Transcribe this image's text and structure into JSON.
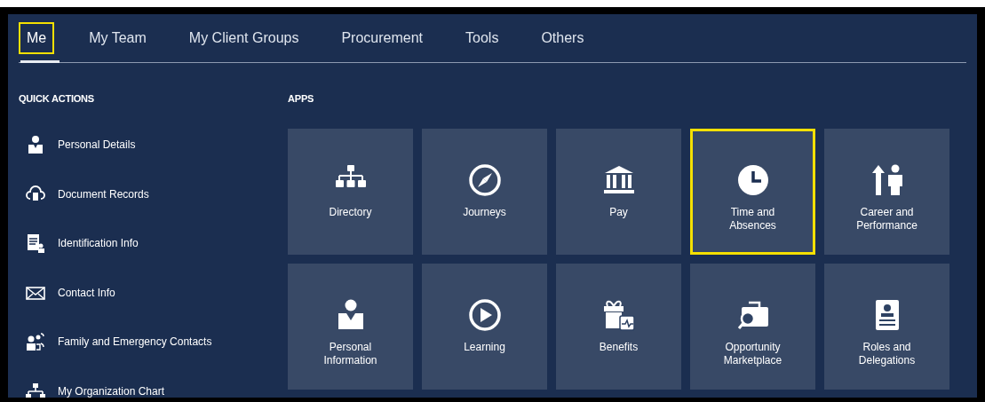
{
  "tabs": [
    {
      "label": "Me",
      "selected": true,
      "highlighted": true
    },
    {
      "label": "My Team",
      "selected": false,
      "highlighted": false
    },
    {
      "label": "My Client Groups",
      "selected": false,
      "highlighted": false
    },
    {
      "label": "Procurement",
      "selected": false,
      "highlighted": false
    },
    {
      "label": "Tools",
      "selected": false,
      "highlighted": false
    },
    {
      "label": "Others",
      "selected": false,
      "highlighted": false
    }
  ],
  "quick_actions": {
    "title": "QUICK ACTIONS",
    "items": [
      {
        "label": "Personal Details"
      },
      {
        "label": "Document Records"
      },
      {
        "label": "Identification Info"
      },
      {
        "label": "Contact Info"
      },
      {
        "label": "Family and Emergency Contacts"
      },
      {
        "label": "My Organization Chart"
      }
    ]
  },
  "apps": {
    "title": "APPS",
    "tiles": [
      {
        "label": "Directory",
        "highlighted": false
      },
      {
        "label": "Journeys",
        "highlighted": false
      },
      {
        "label": "Pay",
        "highlighted": false
      },
      {
        "label": "Time and Absences",
        "highlighted": true
      },
      {
        "label": "Career and Performance",
        "highlighted": false
      },
      {
        "label": "Personal Information",
        "highlighted": false
      },
      {
        "label": "Learning",
        "highlighted": false
      },
      {
        "label": "Benefits",
        "highlighted": false
      },
      {
        "label": "Opportunity Marketplace",
        "highlighted": false
      },
      {
        "label": "Roles and Delegations",
        "highlighted": false
      }
    ]
  }
}
